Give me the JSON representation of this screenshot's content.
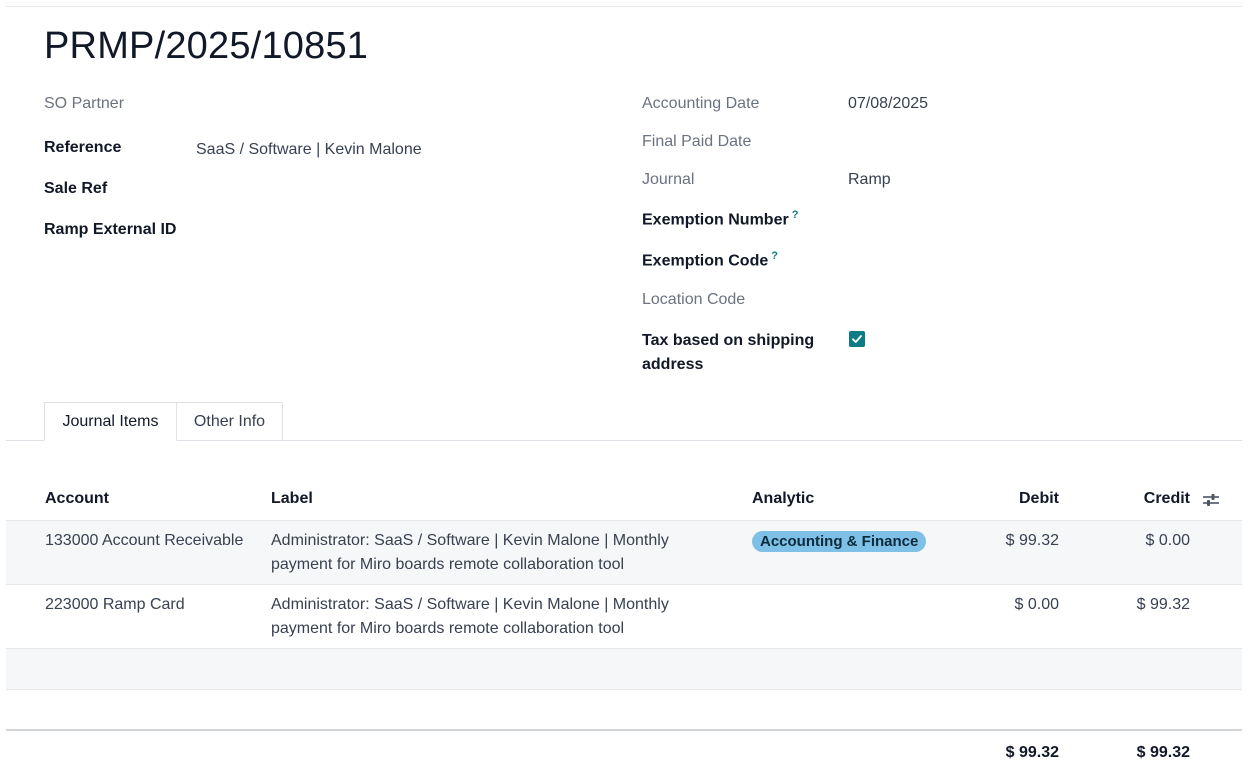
{
  "record": {
    "title": "PRMP/2025/10851"
  },
  "left_fields": {
    "so_partner_label": "SO Partner",
    "reference_label": "Reference",
    "reference_value": "SaaS / Software | Kevin Malone",
    "sale_ref_label": "Sale Ref",
    "ramp_external_id_label": "Ramp External ID"
  },
  "right_fields": {
    "accounting_date_label": "Accounting Date",
    "accounting_date_value": "07/08/2025",
    "final_paid_date_label": "Final Paid Date",
    "journal_label": "Journal",
    "journal_value": "Ramp",
    "exemption_number_label": "Exemption Number",
    "exemption_code_label": "Exemption Code",
    "help_mark": "?",
    "location_code_label": "Location Code",
    "tax_shipping_label_line1": "Tax based on shipping",
    "tax_shipping_label_line2": "address",
    "tax_shipping_checked": true
  },
  "tabs": [
    {
      "label": "Journal Items",
      "active": true
    },
    {
      "label": "Other Info",
      "active": false
    }
  ],
  "table": {
    "headers": {
      "account": "Account",
      "label": "Label",
      "analytic": "Analytic",
      "debit": "Debit",
      "credit": "Credit"
    },
    "rows": [
      {
        "account": "133000 Account Receivable",
        "label_line1": "Administrator: SaaS / Software | Kevin Malone | Monthly",
        "label_line2": "payment for Miro boards remote collaboration tool",
        "analytic": "Accounting & Finance",
        "debit": "$ 99.32",
        "credit": "$ 0.00"
      },
      {
        "account": "223000 Ramp Card",
        "label_line1": "Administrator: SaaS / Software | Kevin Malone | Monthly",
        "label_line2": "payment for Miro boards remote collaboration tool",
        "analytic": "",
        "debit": "$ 0.00",
        "credit": "$ 99.32"
      }
    ],
    "totals": {
      "debit": "$ 99.32",
      "credit": "$ 99.32"
    }
  },
  "colors": {
    "accent": "#0f7b84",
    "badge": "#7ec0e6"
  }
}
